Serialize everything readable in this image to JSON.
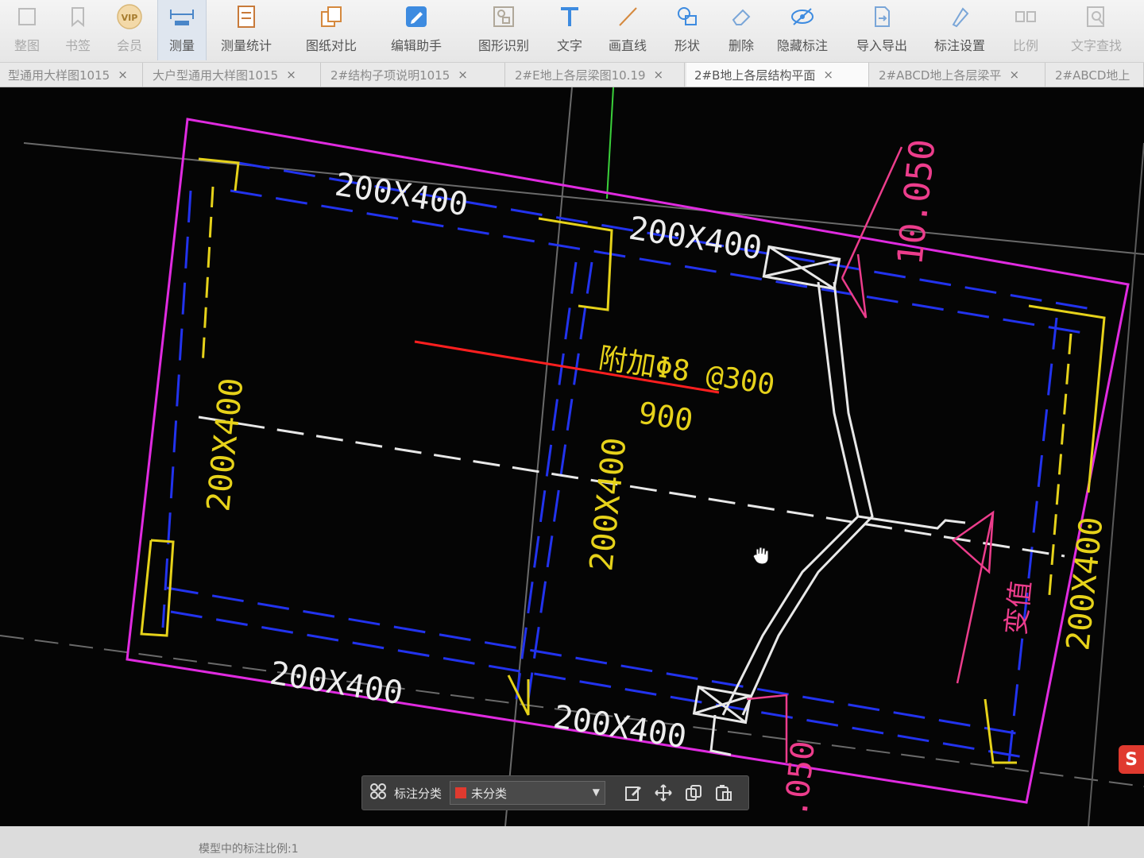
{
  "toolbar": {
    "items": [
      {
        "label": "整图",
        "icon": "fit-view-icon"
      },
      {
        "label": "书签",
        "icon": "bookmark-icon"
      },
      {
        "label": "会员",
        "icon": "vip-icon",
        "badge": "VIP"
      },
      {
        "label": "测量",
        "icon": "measure-icon"
      },
      {
        "label": "测量统计",
        "icon": "measure-stats-icon"
      },
      {
        "label": "图纸对比",
        "icon": "compare-icon"
      },
      {
        "label": "编辑助手",
        "icon": "edit-assistant-icon"
      },
      {
        "label": "图形识别",
        "icon": "shape-recognition-icon"
      },
      {
        "label": "文字",
        "icon": "text-icon"
      },
      {
        "label": "画直线",
        "icon": "line-icon"
      },
      {
        "label": "形状",
        "icon": "shape-icon"
      },
      {
        "label": "删除",
        "icon": "eraser-icon"
      },
      {
        "label": "隐藏标注",
        "icon": "hide-annotation-icon"
      },
      {
        "label": "导入导出",
        "icon": "import-export-icon"
      },
      {
        "label": "标注设置",
        "icon": "annotation-settings-icon"
      },
      {
        "label": "比例",
        "icon": "scale-icon"
      },
      {
        "label": "文字查找",
        "icon": "text-search-icon"
      }
    ]
  },
  "tabs": [
    {
      "label": "型通用大样图1015"
    },
    {
      "label": "大户型通用大样图1015"
    },
    {
      "label": "2#结构子项说明1015"
    },
    {
      "label": "2#E地上各层梁图10.19"
    },
    {
      "label": "2#B地上各层结构平面"
    },
    {
      "label": "2#ABCD地上各层梁平"
    },
    {
      "label": "2#ABCD地上"
    }
  ],
  "drawing": {
    "beam_top_left": "200X400",
    "beam_top_right": "200X400",
    "beam_left": "200X400",
    "beam_center": "200X400",
    "beam_right": "200X400",
    "beam_bottom_left": "200X400",
    "beam_bottom_right": "200X400",
    "rebar_note": "附加Φ8 @300",
    "rebar_length": "900",
    "elevation_top": "10.050",
    "elevation_bottom": ".050",
    "variable_label": "变值"
  },
  "floatbar": {
    "label": "标注分类",
    "selected": "未分类",
    "swatch_color": "#e03a2f"
  },
  "status": {
    "text": "模型中的标注比例:1"
  },
  "logo": {
    "text": "S"
  }
}
